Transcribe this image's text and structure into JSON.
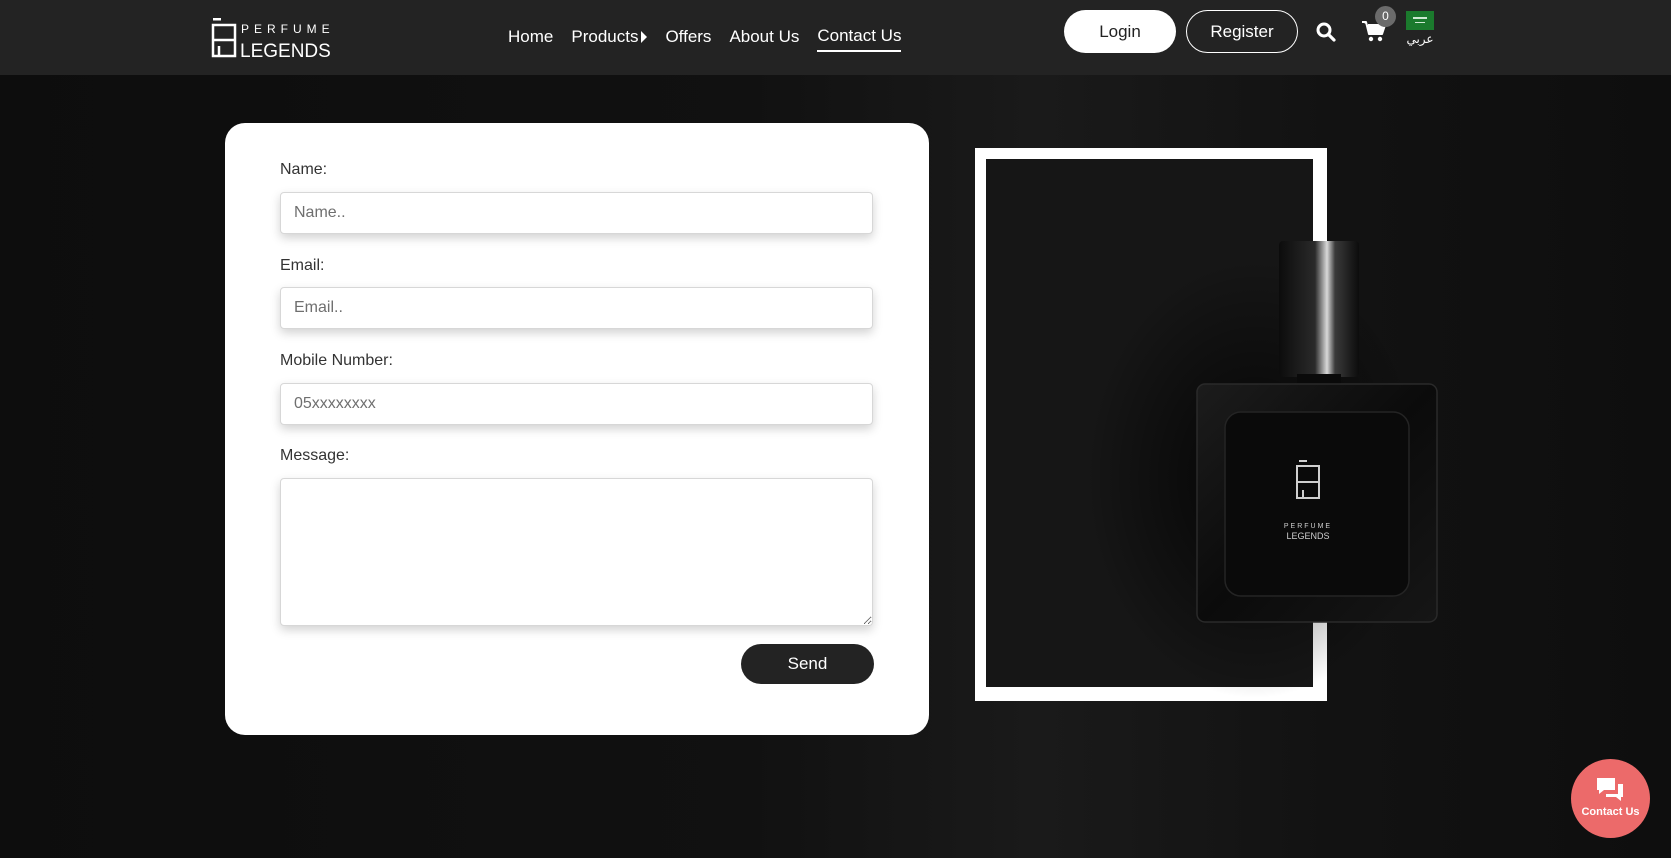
{
  "brand": {
    "logo_top": "PERFUME",
    "logo_bottom": "LEGENDS"
  },
  "nav": {
    "items": [
      {
        "label": "Home"
      },
      {
        "label": "Products"
      },
      {
        "label": "Offers"
      },
      {
        "label": "About Us"
      },
      {
        "label": "Contact Us",
        "active": true
      }
    ]
  },
  "header": {
    "login_label": "Login",
    "register_label": "Register",
    "cart_count": "0",
    "language_label": "عربي",
    "icons": [
      "search-icon",
      "cart-icon",
      "saudi-flag-icon"
    ]
  },
  "form": {
    "name_label": "Name:",
    "name_placeholder": "Name..",
    "email_label": "Email:",
    "email_placeholder": "Email..",
    "mobile_label": "Mobile Number:",
    "mobile_placeholder": "05xxxxxxxx",
    "message_label": "Message:",
    "message_value": "",
    "send_label": "Send"
  },
  "product_image": {
    "bottle_logo_top": "PERFUME",
    "bottle_logo_bottom": "LEGENDS"
  },
  "contact_fab": {
    "label": "Contact Us",
    "icon": "chat-icon",
    "color": "#ec6a6a"
  },
  "colors": {
    "header_bg": "#232323",
    "page_bg": "#111111",
    "card_bg": "#ffffff",
    "send_button_bg": "#232323"
  }
}
